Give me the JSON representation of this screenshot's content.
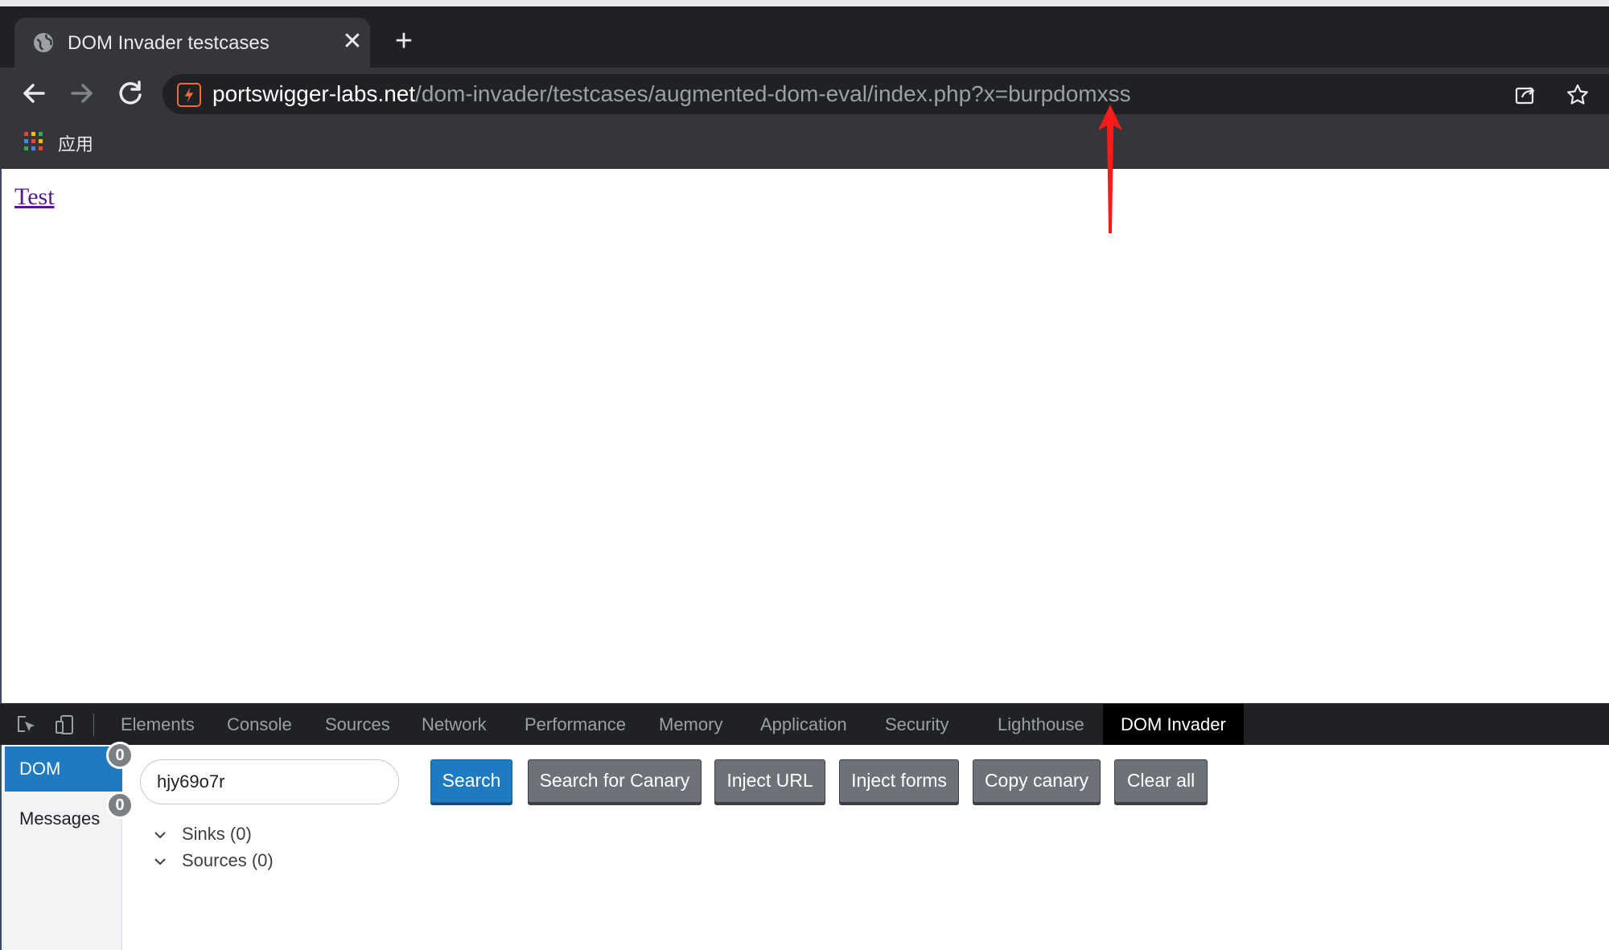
{
  "browser": {
    "tab_title": "DOM Invader testcases",
    "address": {
      "host": "portswigger-labs.net",
      "path": "/dom-invader/testcases/augmented-dom-eval/index.php?x=burpdomxss"
    },
    "bookmarks": [
      {
        "label": "应用"
      }
    ]
  },
  "page": {
    "link_text": "Test",
    "annotation_color": "#ff1a1a"
  },
  "devtools": {
    "tabs": [
      {
        "label": "Elements"
      },
      {
        "label": "Console"
      },
      {
        "label": "Sources"
      },
      {
        "label": "Network"
      },
      {
        "label": "Performance"
      },
      {
        "label": "Memory"
      },
      {
        "label": "Application"
      },
      {
        "label": "Security"
      },
      {
        "label": "Lighthouse"
      },
      {
        "label": "DOM Invader",
        "active": true
      }
    ],
    "sidebar": [
      {
        "label": "DOM",
        "count": "0",
        "active": true
      },
      {
        "label": "Messages",
        "count": "0"
      }
    ],
    "canary_value": "hjy69o7r",
    "buttons": [
      {
        "label": "Search"
      },
      {
        "label": "Search for Canary"
      },
      {
        "label": "Inject URL"
      },
      {
        "label": "Inject forms"
      },
      {
        "label": "Copy canary"
      },
      {
        "label": "Clear all"
      }
    ],
    "tree": [
      {
        "label": "Sinks (0)"
      },
      {
        "label": "Sources (0)"
      }
    ]
  }
}
